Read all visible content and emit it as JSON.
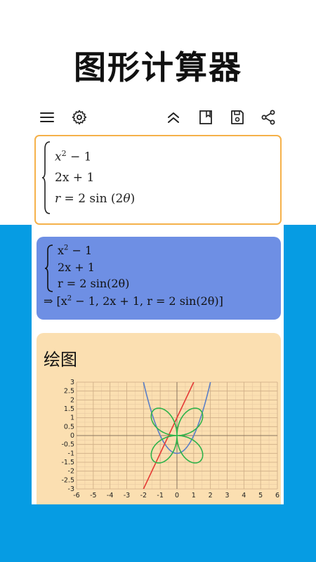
{
  "promo": {
    "title": "图形计算器"
  },
  "toolbar": {
    "icons": [
      "menu-icon",
      "gear-icon",
      "chevrons-up-icon",
      "bookmark-icon",
      "save-icon",
      "share-icon"
    ]
  },
  "input": {
    "line1_base": "x",
    "line1_exp": "2",
    "line1_rest": " − 1",
    "line2": "2x + 1",
    "line3_var": "r",
    "line3_rest": " = 2 sin (2",
    "line3_theta": "θ",
    "line3_end": ")"
  },
  "result": {
    "line1_base": "x",
    "line1_exp": "2",
    "line1_rest": " − 1",
    "line2": "2x + 1",
    "line3": "r = 2 sin(2θ)",
    "implies_a": "⇒ [x",
    "implies_exp": "2",
    "implies_b": " − 1, 2x + 1, r = 2 sin(2θ)]"
  },
  "plot": {
    "title": "绘图"
  },
  "colors": {
    "accent_border": "#f5b14a",
    "result_bg": "#6e8fe4",
    "plot_bg": "#fbdfb1",
    "band": "#069ce3",
    "series_parabola": "#5b7fc6",
    "series_line": "#e53935",
    "series_polar": "#2eb34a"
  },
  "chart_data": {
    "type": "line",
    "xlim": [
      -6,
      6
    ],
    "ylim": [
      -3,
      3
    ],
    "grid": true,
    "x_ticks": [
      "-6",
      "-5",
      "-4",
      "-3",
      "-2",
      "-1",
      "0",
      "1",
      "2",
      "3",
      "4",
      "5",
      "6"
    ],
    "y_ticks": [
      "3",
      "2.5",
      "2",
      "1.5",
      "1",
      "0.5",
      "0",
      "-0.5",
      "-1",
      "-1.5",
      "-2",
      "-2.5",
      "-3"
    ],
    "series": [
      {
        "expression": "y = x^2 - 1",
        "kind": "cartesian"
      },
      {
        "expression": "y = 2x + 1",
        "kind": "cartesian"
      },
      {
        "expression": "r = 2 sin(2θ)",
        "kind": "polar"
      }
    ]
  }
}
